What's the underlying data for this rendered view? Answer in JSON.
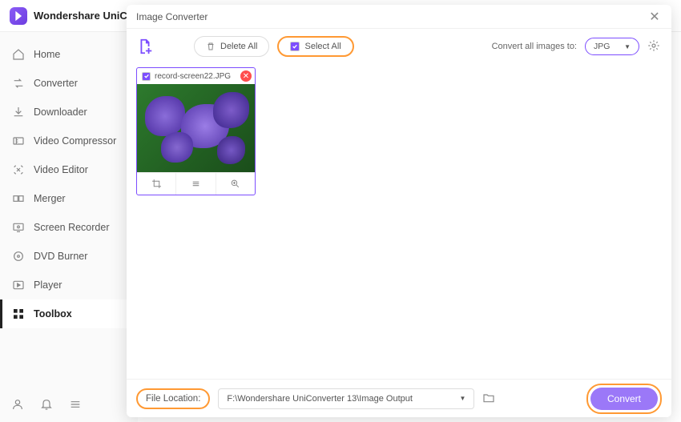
{
  "app": {
    "title": "Wondershare UniCon"
  },
  "sidebar": {
    "items": [
      {
        "label": "Home"
      },
      {
        "label": "Converter"
      },
      {
        "label": "Downloader"
      },
      {
        "label": "Video Compressor"
      },
      {
        "label": "Video Editor"
      },
      {
        "label": "Merger"
      },
      {
        "label": "Screen Recorder"
      },
      {
        "label": "DVD Burner"
      },
      {
        "label": "Player"
      },
      {
        "label": "Toolbox"
      }
    ]
  },
  "modal": {
    "title": "Image Converter",
    "toolbar": {
      "delete_all": "Delete All",
      "select_all": "Select All",
      "convert_all_label": "Convert all images to:",
      "format": "JPG"
    },
    "thumb": {
      "filename": "record-screen22.JPG"
    },
    "bottom": {
      "file_location_label": "File Location:",
      "path": "F:\\Wondershare UniConverter 13\\Image Output",
      "convert": "Convert"
    }
  }
}
